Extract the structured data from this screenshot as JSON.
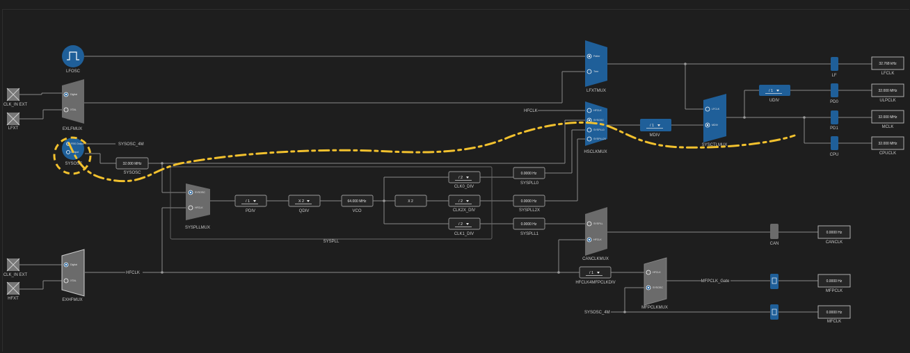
{
  "sources": {
    "lfosc": "LFOSC",
    "clkin_ext_1": "CLK_IN EXT",
    "lfxt": "LFXT",
    "sysosc": "SYSOSC",
    "sysosc_4m": "SYSOSC_4M",
    "clkin_ext_2": "CLK_IN EXT",
    "hfxt": "HFXT",
    "sysosc_4m_bottom": "SYSOSC_4M",
    "hfclk_in": "HFCLK"
  },
  "muxes": {
    "exlfmux": {
      "name": "EXLFMUX",
      "opt1": "Digital",
      "opt2": "XTAL"
    },
    "sysosc_sel": {
      "opt1": "FBS Output",
      "opt2": "Output"
    },
    "exhfmux": {
      "name": "EXHFMUX",
      "opt1": "Digital",
      "opt2": "XTAL"
    },
    "lfxtmux": {
      "name": "LFXTMUX",
      "opt1": "Patter",
      "opt2": "Tree"
    },
    "hsclkmux": {
      "name": "HSCLKMUX",
      "opt1": "HFCLK",
      "opt2": "SYSOSC",
      "opt3": "SYSPLL0",
      "opt4": "SYSPLL2X"
    },
    "sysctlmux": {
      "name": "SYSCTLMUX",
      "opt1": "LFCLK",
      "opt2": "MDIV"
    },
    "syspllmux": {
      "name": "SYSPLLMUX",
      "opt1": "SYSOSC",
      "opt2": "HFCLK"
    },
    "canclkmux": {
      "name": "CANCLKMUX",
      "opt1": "SYSPLL",
      "opt2": "HFCLK"
    },
    "mfpclkmux": {
      "name": "MFPCLKMUX",
      "opt1": "HFCLK",
      "opt2": "SYSOSC"
    }
  },
  "dividers": {
    "pdiv": {
      "value": "/ 1",
      "label": "PDIV"
    },
    "qdiv": {
      "value": "X 2",
      "label": "QDIV"
    },
    "clk0_div": {
      "value": "/ 2",
      "label": "CLK0_DIV"
    },
    "clk2x_div": {
      "value": "/ 2",
      "label": "CLK2X_DIV"
    },
    "clk1_div": {
      "value": "/ 2",
      "label": "CLK1_DIV"
    },
    "mdiv": {
      "value": "/ 1",
      "label": "MDIV"
    },
    "udiv": {
      "value": "/ 1",
      "label": "UDIV"
    },
    "hfclk4mfpclkdiv": {
      "value": "/ 1",
      "label": "HFCLK4MFPCLKDIV"
    }
  },
  "values": {
    "sysosc": {
      "value": "32.000 MHz",
      "label": "SYSOSC"
    },
    "vco": {
      "value": "64.000 MHz",
      "label": "VCO"
    },
    "x2": "X 2",
    "syspll0": {
      "value": "0.0000 Hz",
      "label": "SYSPLL0"
    },
    "syspll2x": {
      "value": "0.0000 Hz",
      "label": "SYSPLL2X"
    },
    "syspll1": {
      "value": "0.0000 Hz",
      "label": "SYSPLL1"
    }
  },
  "syspll_group": "SYSPLL",
  "net_labels": {
    "hfclk_net": "HFCLK",
    "mfpclk_gate": "MFPCLK_Gate"
  },
  "gates": {
    "lf": "LF",
    "pd0": "PD0",
    "pd1": "PD1",
    "cpu": "CPU",
    "can": "CAN"
  },
  "outputs": {
    "lfclk": {
      "value": "32.768 kHz",
      "label": "LFCLK"
    },
    "ulpclk": {
      "value": "32.000 MHz",
      "label": "ULPCLK"
    },
    "mclk": {
      "value": "32.000 MHz",
      "label": "MCLK"
    },
    "cpuclk": {
      "value": "32.000 MHz",
      "label": "CPUCLK"
    },
    "canclk": {
      "value": "0.0000 Hz",
      "label": "CANCLK"
    },
    "mfpclk": {
      "value": "0.0000 Hz",
      "label": "MFPCLK"
    },
    "mfclk": {
      "value": "0.0000 Hz",
      "label": "MFCLK"
    }
  },
  "colors": {
    "background": "#1e1e1e",
    "wire": "#8a8a8a",
    "active_blue": "#1f5f99",
    "inactive_gray": "#6b6b6b",
    "box_border": "#9a9a9a",
    "annotation_yellow": "#f2c12e"
  }
}
